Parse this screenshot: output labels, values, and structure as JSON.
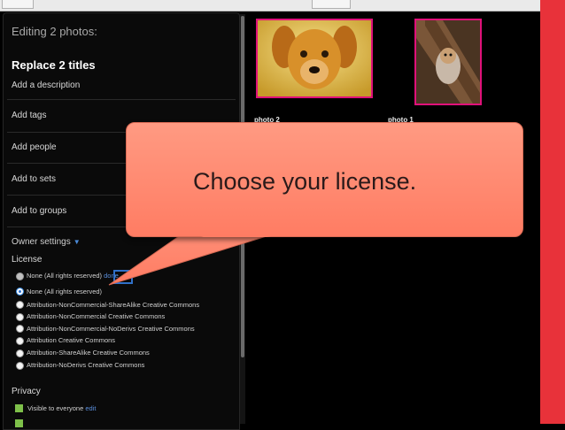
{
  "panel": {
    "editing_header": "Editing 2 photos:",
    "replace_titles": "Replace 2 titles",
    "add_description": "Add a description",
    "add_tags": "Add tags",
    "add_people": "Add people",
    "add_to_sets": "Add to sets",
    "add_to_groups": "Add to groups",
    "owner_settings": "Owner settings",
    "license_heading": "License",
    "license_current": "None (All rights reserved)",
    "license_current_edit": "done",
    "license_options": [
      "None (All rights reserved)",
      "Attribution-NonCommercial-ShareAlike Creative Commons",
      "Attribution-NonCommercial Creative Commons",
      "Attribution-NonCommercial-NoDerivs Creative Commons",
      "Attribution Creative Commons",
      "Attribution-ShareAlike Creative Commons",
      "Attribution-NoDerivs Creative Commons"
    ],
    "selected_option_index": 0,
    "privacy_heading": "Privacy",
    "visible_to_everyone": "Visible to everyone",
    "visible_edit": "edit"
  },
  "photos": [
    {
      "label": "photo 2",
      "subject": "golden-retriever-puppy"
    },
    {
      "label": "photo 1",
      "subject": "dog-in-tree"
    }
  ],
  "callout": {
    "text": "Choose your license."
  },
  "colors": {
    "accent_red": "#e8323a",
    "photo_border": "#e0117a",
    "callout_fill": "#ff8a72",
    "link_blue": "#5b8fdd",
    "checkbox_green": "#7ec04a"
  }
}
